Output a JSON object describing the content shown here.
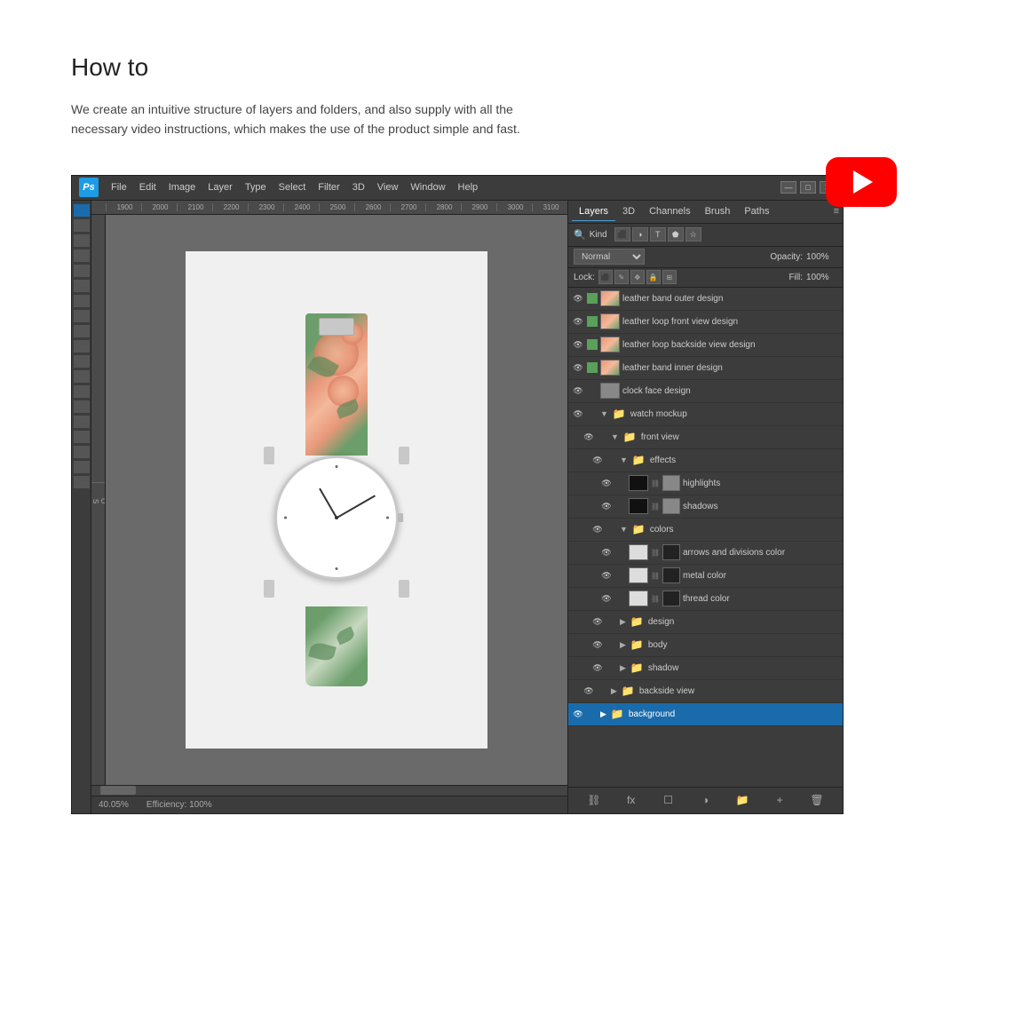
{
  "page": {
    "title": "How to",
    "description": "We create an intuitive structure of layers and folders, and also supply with all the necessary video instructions, which makes the use of the product simple and fast."
  },
  "photoshop": {
    "logo": "Ps",
    "menu_items": [
      "File",
      "Edit",
      "Image",
      "Layer",
      "Type",
      "Select",
      "Filter",
      "3D",
      "View",
      "Window",
      "Help"
    ],
    "window_controls": [
      "—",
      "□",
      "✕"
    ],
    "ruler_marks": [
      "1900",
      "2000",
      "2100",
      "2200",
      "2300",
      "2400",
      "2500",
      "2600",
      "2700",
      "2800",
      "2900",
      "3000",
      "3100"
    ],
    "status_bar": {
      "zoom": "40.05%",
      "efficiency": "Efficiency: 100%"
    }
  },
  "layers_panel": {
    "tabs": [
      "Layers",
      "3D",
      "Channels",
      "Brush",
      "Paths"
    ],
    "active_tab": "Layers",
    "filter_kind": "Kind",
    "blend_mode": "Normal",
    "opacity_label": "Opacity:",
    "opacity_value": "100%",
    "lock_label": "Lock:",
    "fill_label": "Fill:",
    "fill_value": "100%",
    "layers": [
      {
        "id": 1,
        "indent": 0,
        "type": "layer",
        "name": "leather band outer design",
        "color": "green",
        "visible": true
      },
      {
        "id": 2,
        "indent": 0,
        "type": "layer",
        "name": "leather loop front view design",
        "color": "green",
        "visible": true
      },
      {
        "id": 3,
        "indent": 0,
        "type": "layer",
        "name": "leather loop backside view design",
        "color": "green",
        "visible": true
      },
      {
        "id": 4,
        "indent": 0,
        "type": "layer",
        "name": "leather band inner design",
        "color": "green",
        "visible": true
      },
      {
        "id": 5,
        "indent": 0,
        "type": "layer",
        "name": "clock face design",
        "color": "none",
        "visible": true
      },
      {
        "id": 6,
        "indent": 0,
        "type": "folder",
        "name": "watch mockup",
        "open": true,
        "visible": true
      },
      {
        "id": 7,
        "indent": 1,
        "type": "folder",
        "name": "front view",
        "open": true,
        "visible": true
      },
      {
        "id": 8,
        "indent": 2,
        "type": "folder",
        "name": "effects",
        "open": true,
        "visible": true
      },
      {
        "id": 9,
        "indent": 3,
        "type": "layer",
        "name": "highlights",
        "color": "none",
        "visible": true,
        "hasMask": true
      },
      {
        "id": 10,
        "indent": 3,
        "type": "layer",
        "name": "shadows",
        "color": "none",
        "visible": true,
        "hasMask": true
      },
      {
        "id": 11,
        "indent": 2,
        "type": "folder",
        "name": "colors",
        "open": true,
        "visible": true
      },
      {
        "id": 12,
        "indent": 3,
        "type": "layer",
        "name": "arrows and divisions color",
        "color": "none",
        "visible": true
      },
      {
        "id": 13,
        "indent": 3,
        "type": "layer",
        "name": "metal color",
        "color": "none",
        "visible": true
      },
      {
        "id": 14,
        "indent": 3,
        "type": "layer",
        "name": "thread color",
        "color": "none",
        "visible": true
      },
      {
        "id": 15,
        "indent": 2,
        "type": "folder",
        "name": "design",
        "open": false,
        "visible": true
      },
      {
        "id": 16,
        "indent": 2,
        "type": "folder",
        "name": "body",
        "open": false,
        "visible": true
      },
      {
        "id": 17,
        "indent": 2,
        "type": "folder",
        "name": "shadow",
        "open": false,
        "visible": true
      },
      {
        "id": 18,
        "indent": 1,
        "type": "folder",
        "name": "backside view",
        "open": false,
        "visible": true
      },
      {
        "id": 19,
        "indent": 0,
        "type": "folder",
        "name": "background",
        "open": false,
        "visible": true,
        "active": true
      }
    ],
    "bottom_buttons": [
      "link",
      "fx",
      "new-layer",
      "mask",
      "folder",
      "adjustment",
      "delete"
    ]
  }
}
